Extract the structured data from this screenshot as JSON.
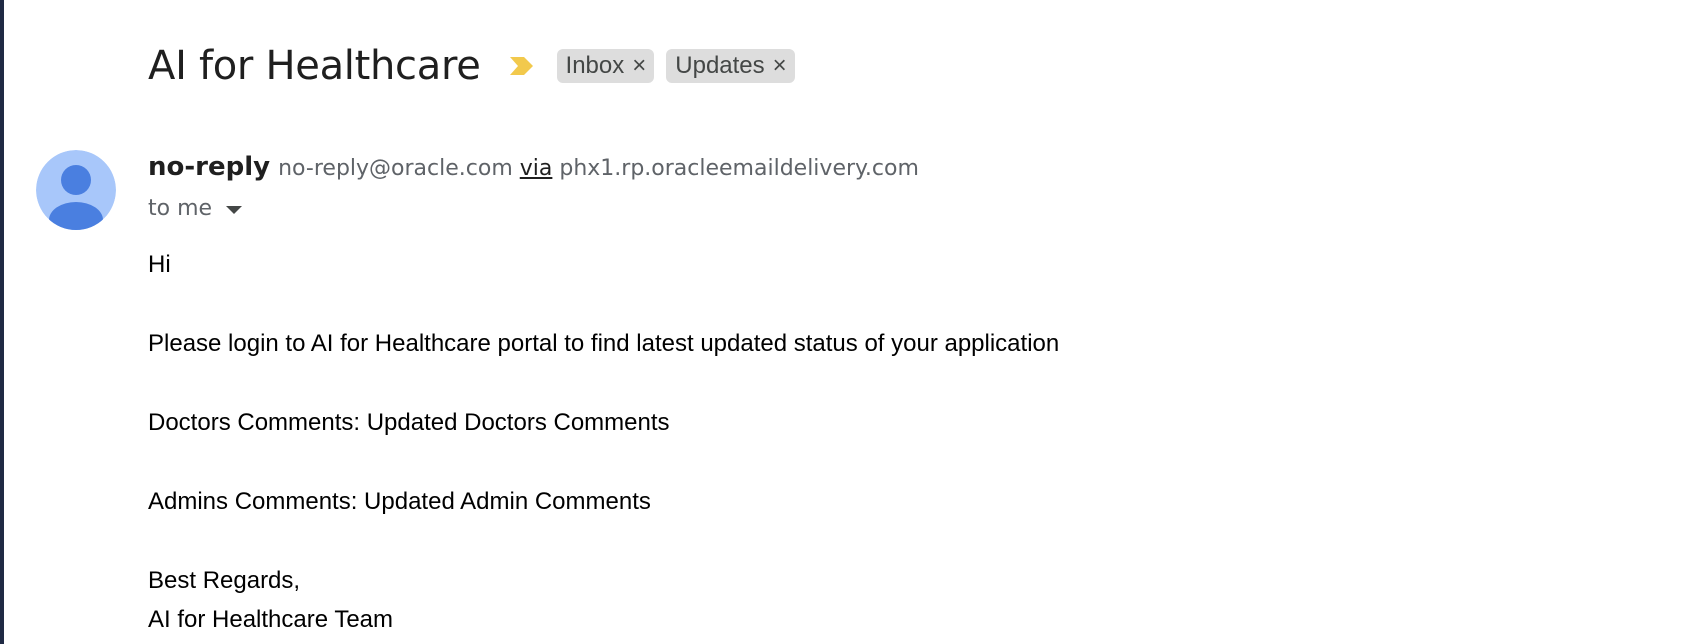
{
  "email": {
    "subject": "AI for Healthcare",
    "labels": [
      {
        "name": "Inbox",
        "close": "×"
      },
      {
        "name": "Updates",
        "close": "×"
      }
    ],
    "sender": {
      "name": "no-reply",
      "email": "no-reply@oracle.com",
      "via_label": "via",
      "via_domain": "phx1.rp.oracleemaildelivery.com"
    },
    "recipient": "to me",
    "body": {
      "greeting": "Hi",
      "paragraph": "Please login to AI for Healthcare portal to find latest updated status of your application",
      "doctors_comments": "Doctors Comments: Updated Doctors Comments",
      "admins_comments": "Admins Comments: Updated Admin Comments",
      "closing": "Best Regards,",
      "signature": "AI for Healthcare Team"
    }
  },
  "colors": {
    "importance_marker": "#f2c94c",
    "label_chip_bg": "#dddddd",
    "avatar_bg": "#a8c7fa",
    "avatar_figure": "#4a7fe0"
  },
  "icons": {
    "importance": "importance-marker-icon",
    "avatar": "default-avatar-icon",
    "dropdown": "chevron-down-icon"
  }
}
